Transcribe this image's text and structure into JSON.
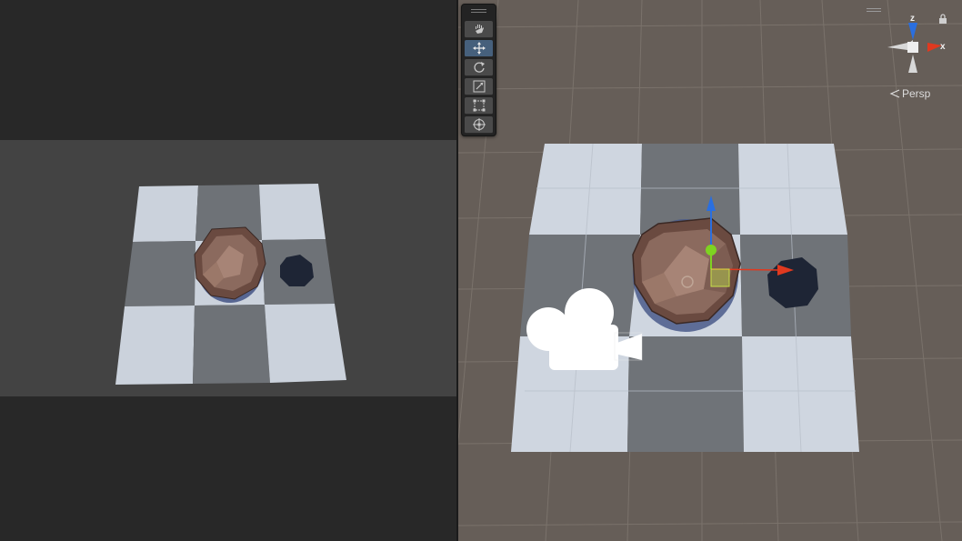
{
  "scene_view": {
    "toolbar": {
      "tools": [
        {
          "name": "hand-tool",
          "icon": "hand-icon",
          "active": false
        },
        {
          "name": "move-tool",
          "icon": "move-icon",
          "active": true
        },
        {
          "name": "rotate-tool",
          "icon": "rotate-icon",
          "active": false
        },
        {
          "name": "scale-tool",
          "icon": "scale-icon",
          "active": false
        },
        {
          "name": "rect-tool",
          "icon": "rect-transform-icon",
          "active": false
        },
        {
          "name": "transform-tool",
          "icon": "transform-icon",
          "active": false
        }
      ]
    },
    "orientation_gizmo": {
      "z_label": "z",
      "x_label": "x",
      "projection_label": "Persp"
    },
    "colors": {
      "tile_light": "#cfd6e0",
      "tile_dark": "#6f7378",
      "background": "#665e58",
      "grid_line": "#7a726b",
      "axis_x": "#e0391f",
      "axis_y": "#7ed321",
      "axis_z": "#2a6fe0",
      "toolbar_active": "#46607c"
    }
  },
  "game_view": {
    "colors": {
      "background": "#282828",
      "viewport": "#434343",
      "tile_light": "#cbd2dc",
      "tile_dark": "#6e7277"
    }
  }
}
